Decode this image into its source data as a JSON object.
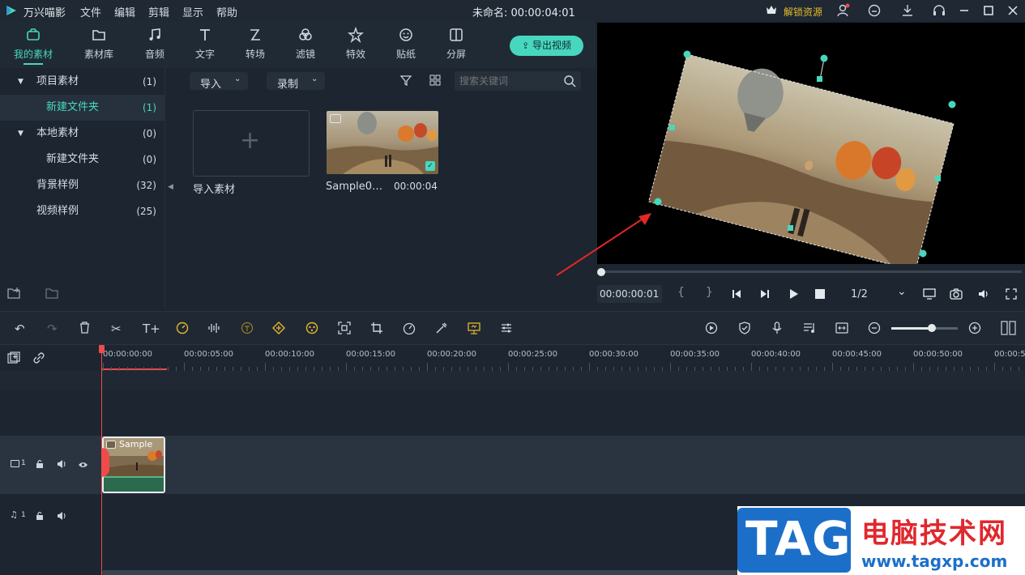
{
  "app": {
    "name": "万兴喵影",
    "project_title": "未命名: 00:00:04:01",
    "unlock_label": "解锁资源"
  },
  "menu": [
    "文件",
    "编辑",
    "剪辑",
    "显示",
    "帮助"
  ],
  "toolbar": {
    "tabs": [
      {
        "label": "我的素材",
        "icon": "folder-box-icon"
      },
      {
        "label": "素材库",
        "icon": "folder-icon"
      },
      {
        "label": "音频",
        "icon": "music-note-icon"
      },
      {
        "label": "文字",
        "icon": "text-icon"
      },
      {
        "label": "转场",
        "icon": "transition-icon"
      },
      {
        "label": "滤镜",
        "icon": "filter-icon"
      },
      {
        "label": "特效",
        "icon": "effects-icon"
      },
      {
        "label": "贴纸",
        "icon": "sticker-icon"
      },
      {
        "label": "分屏",
        "icon": "split-screen-icon"
      }
    ],
    "export_label": "导出视频"
  },
  "sidebar": {
    "items": [
      {
        "label": "项目素材",
        "count": "(1)"
      },
      {
        "label": "新建文件夹",
        "count": "(1)"
      },
      {
        "label": "本地素材",
        "count": "(0)"
      },
      {
        "label": "新建文件夹",
        "count": "(0)"
      },
      {
        "label": "背景样例",
        "count": "(32)"
      },
      {
        "label": "视频样例",
        "count": "(25)"
      }
    ]
  },
  "media": {
    "import_label": "导入",
    "record_label": "录制",
    "search_placeholder": "搜索关键词",
    "import_tile_label": "导入素材",
    "clip_name": "Sample0…",
    "clip_duration": "00:00:04"
  },
  "player": {
    "current_time": "00:00:00:01",
    "quality": "1/2",
    "brace_left": "{",
    "brace_right": "}"
  },
  "timeline": {
    "ruler_ticks": [
      "00:00:00:00",
      "00:00:05:00",
      "00:00:10:00",
      "00:00:15:00",
      "00:00:20:00",
      "00:00:25:00",
      "00:00:30:00",
      "00:00:35:00",
      "00:00:40:00",
      "00:00:45:00",
      "00:00:50:00",
      "00:00:5"
    ],
    "video_track_label": "1",
    "audio_track_label": "1",
    "clip_label": "Sample"
  },
  "watermark": {
    "logo_text": "TAG",
    "site_name": "电脑技术网",
    "site_url": "www.tagxp.com"
  },
  "colors": {
    "accent": "#47d7bf",
    "playhead": "#f04b4b",
    "highlight_yellow": "#e5b92c"
  }
}
